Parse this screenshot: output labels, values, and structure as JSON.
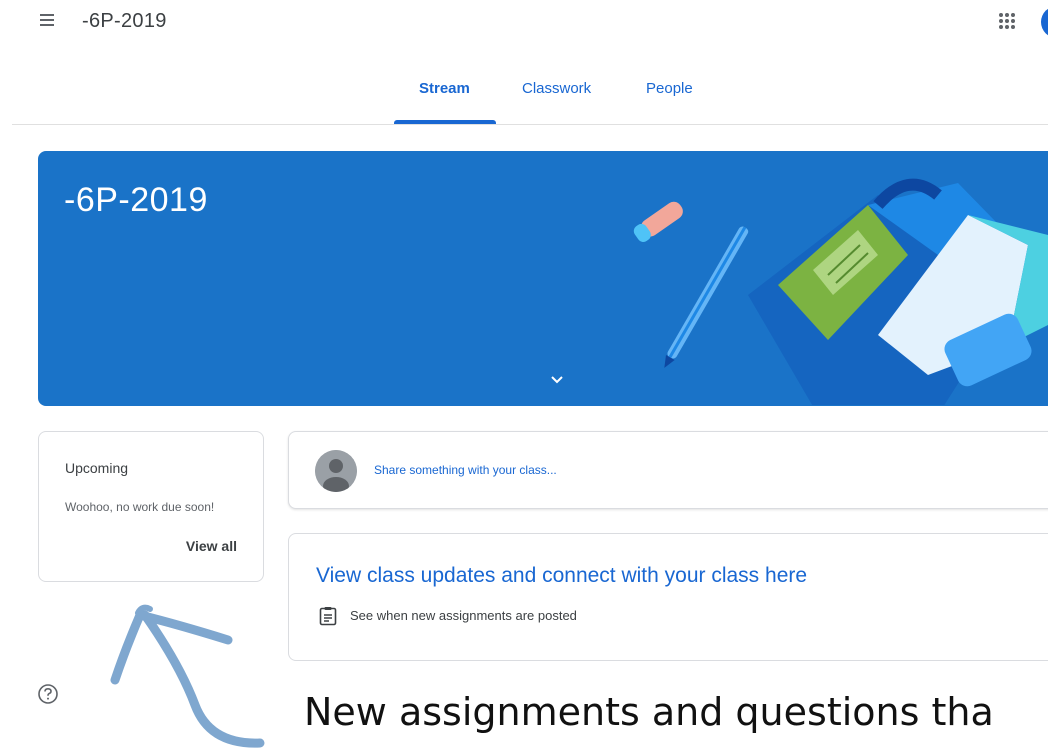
{
  "header": {
    "class_name": "-6P-2019",
    "menu_icon": "menu-icon",
    "apps_icon": "apps-grid-icon"
  },
  "tabs": [
    {
      "label": "Stream",
      "active": true
    },
    {
      "label": "Classwork",
      "active": false
    },
    {
      "label": "People",
      "active": false
    }
  ],
  "banner": {
    "title": "-6P-2019",
    "color": "#1a73c8"
  },
  "upcoming": {
    "title": "Upcoming",
    "message": "Woohoo, no work due soon!",
    "link": "View all"
  },
  "share": {
    "placeholder": "Share something with your class..."
  },
  "info": {
    "title": "View class updates and connect with your class here",
    "detail": "See when new assignments are posted"
  },
  "annotation": {
    "text": "New assignments and questions tha"
  },
  "colors": {
    "accent": "#1967d2",
    "arrow": "#7fa7cf"
  }
}
